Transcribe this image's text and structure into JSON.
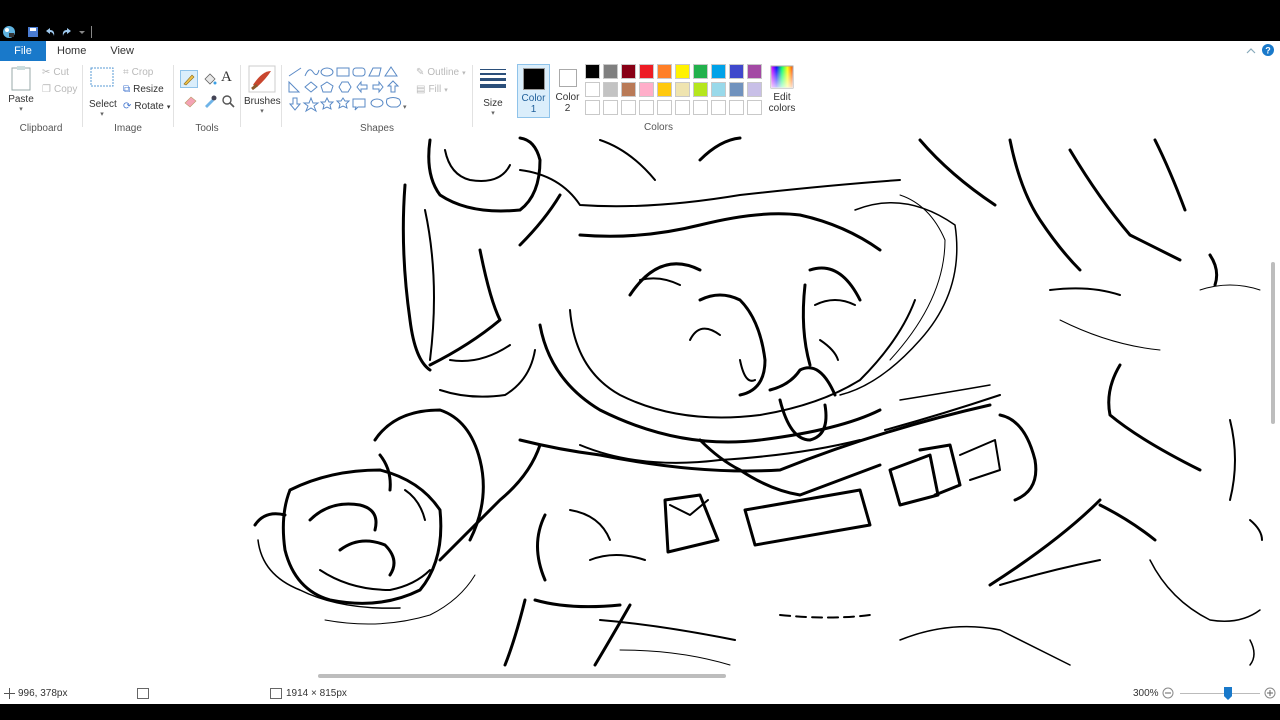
{
  "tabs": {
    "file": "File",
    "home": "Home",
    "view": "View"
  },
  "clipboard": {
    "paste": "Paste",
    "cut": "Cut",
    "copy": "Copy",
    "label": "Clipboard"
  },
  "image": {
    "select": "Select",
    "crop": "Crop",
    "resize": "Resize",
    "rotate": "Rotate",
    "label": "Image"
  },
  "tools": {
    "label": "Tools",
    "text_glyph": "A"
  },
  "brushes": {
    "label": "Brushes"
  },
  "shapes": {
    "outline": "Outline",
    "fill": "Fill",
    "label": "Shapes"
  },
  "size": {
    "label": "Size"
  },
  "color1": {
    "line1": "Color",
    "line2": "1"
  },
  "color2": {
    "line1": "Color",
    "line2": "2"
  },
  "colors": {
    "label": "Colors",
    "edit_line1": "Edit",
    "edit_line2": "colors",
    "row1": [
      "#000000",
      "#7f7f7f",
      "#880015",
      "#ed1c24",
      "#ff7f27",
      "#fff200",
      "#22b14c",
      "#00a2e8",
      "#3f48cc",
      "#a349a4"
    ],
    "row2": [
      "#ffffff",
      "#c3c3c3",
      "#b97a57",
      "#ffaec9",
      "#ffc90e",
      "#efe4b0",
      "#b5e61d",
      "#99d9ea",
      "#7092be",
      "#c8bfe7"
    ],
    "row3": [
      "#ffffff",
      "#ffffff",
      "#ffffff",
      "#ffffff",
      "#ffffff",
      "#ffffff",
      "#ffffff",
      "#ffffff",
      "#ffffff",
      "#ffffff"
    ]
  },
  "status": {
    "cursor_pos": "996, 378px",
    "image_size": "1914 × 815px",
    "zoom": "300%"
  }
}
